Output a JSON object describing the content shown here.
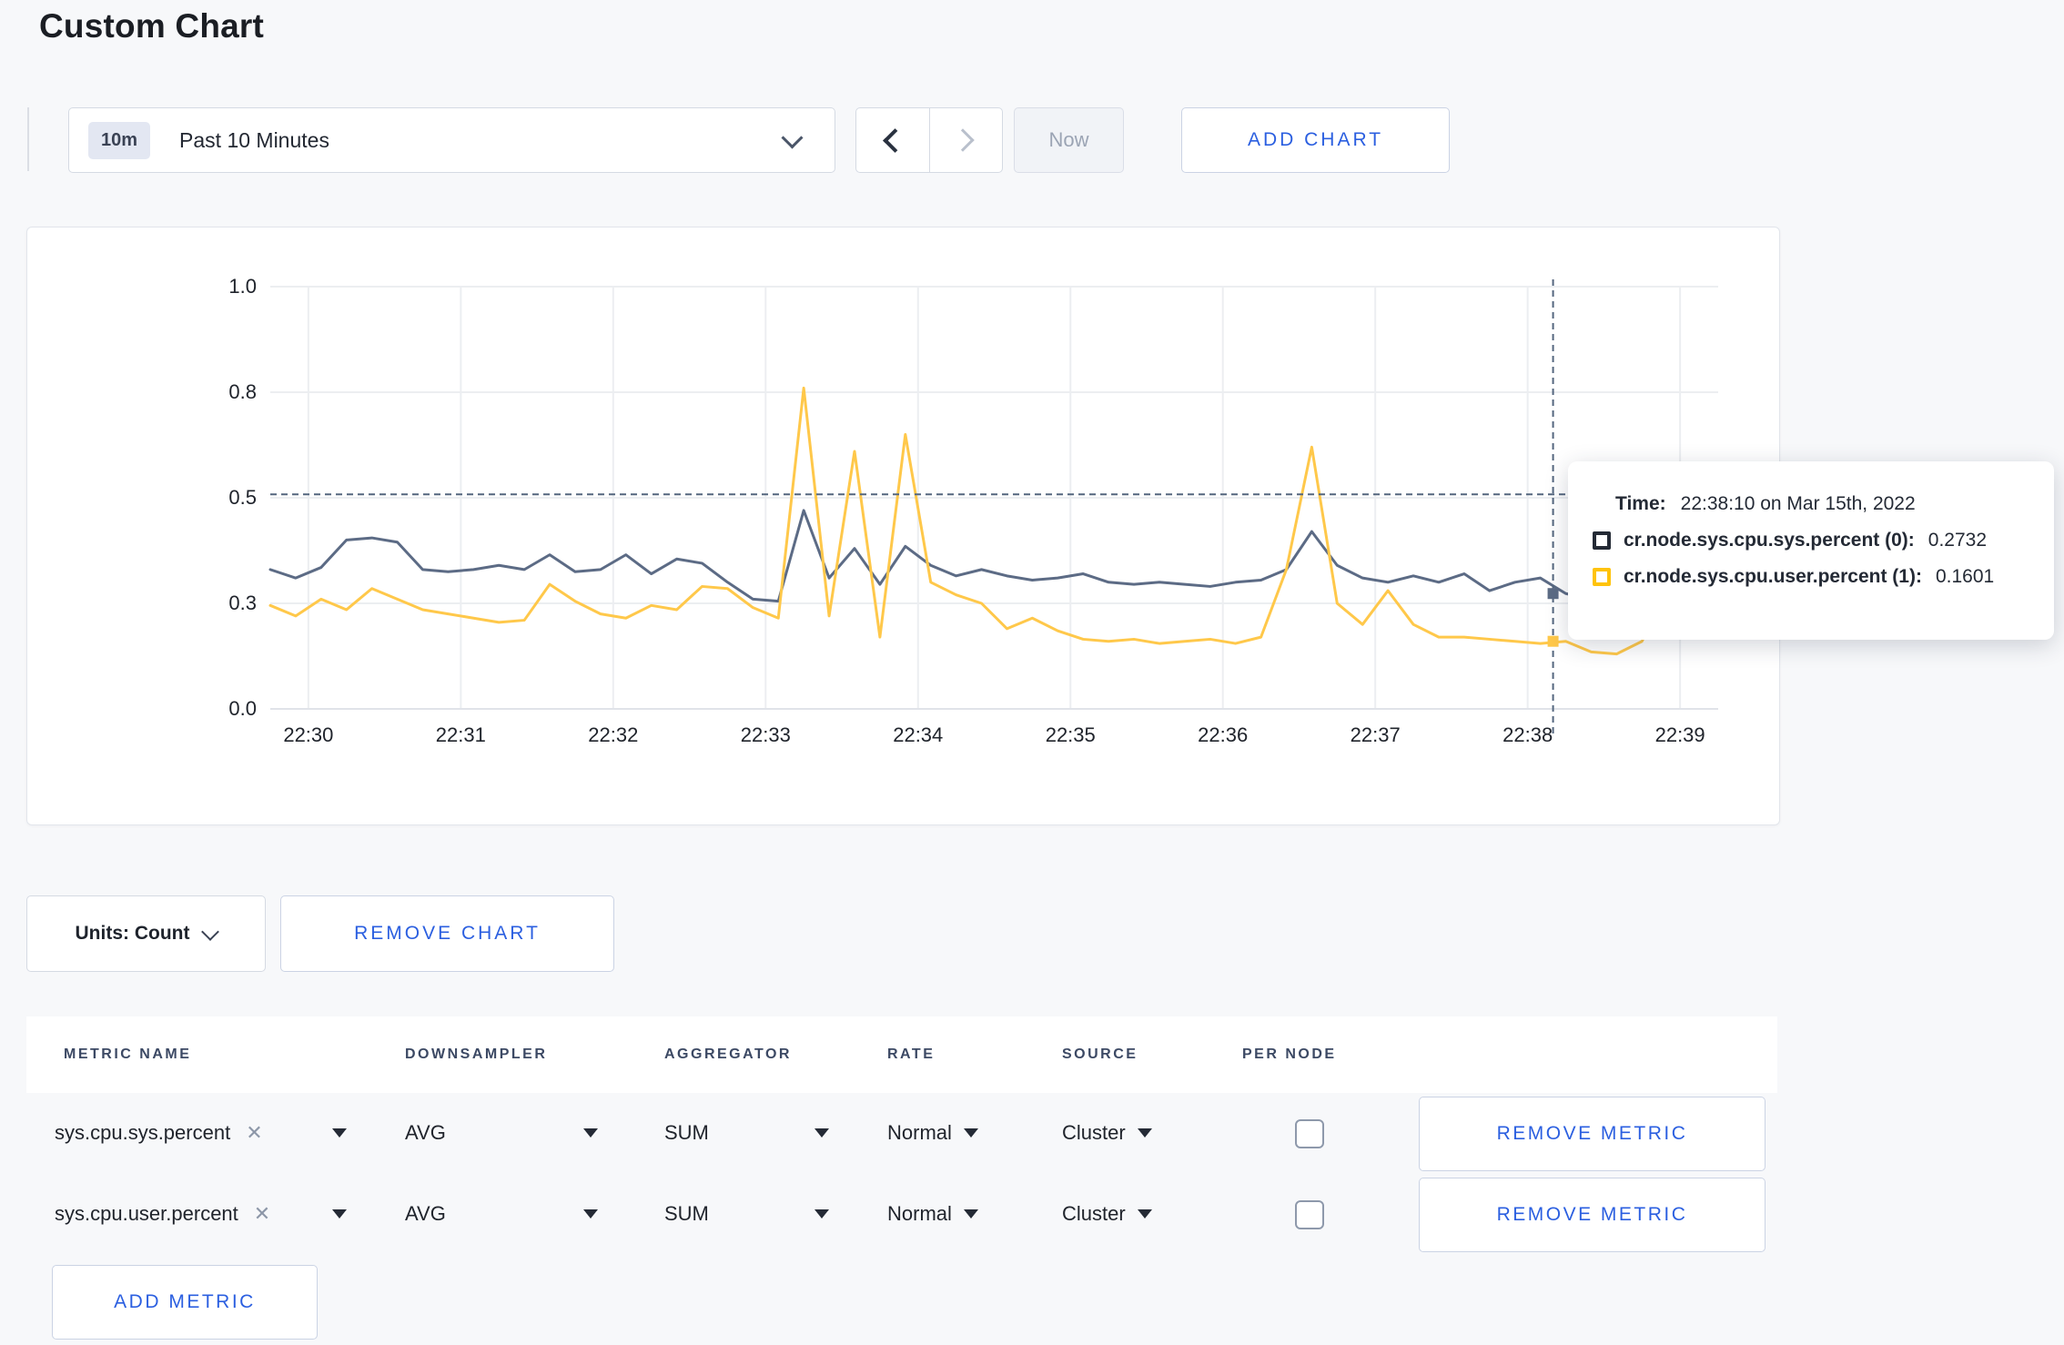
{
  "page": {
    "title": "Custom Chart"
  },
  "colors": {
    "accent_blue": "#2B5FE0",
    "navy_text": "#242A35",
    "series_sys": "#5C6B85",
    "series_user": "#FFC84A",
    "crosshair": "#54667E",
    "gridline": "#ECEEF1",
    "page_background": "#F7F8FA"
  },
  "toolbar": {
    "range_badge": "10m",
    "range_label": "Past 10 Minutes",
    "now_label": "Now",
    "add_chart_label": "ADD CHART"
  },
  "chart_data": {
    "type": "line",
    "title": "",
    "xlabel": "",
    "ylabel": "",
    "x_unit": "seconds after 22:29:45 on Mar 15th, 2022",
    "x_seconds": [
      0,
      10,
      20,
      30,
      40,
      50,
      60,
      70,
      80,
      90,
      100,
      110,
      120,
      130,
      140,
      150,
      160,
      170,
      180,
      190,
      200,
      210,
      220,
      230,
      240,
      250,
      260,
      270,
      280,
      290,
      300,
      310,
      320,
      330,
      340,
      350,
      360,
      370,
      380,
      390,
      400,
      410,
      420,
      430,
      440,
      450,
      460,
      470,
      480,
      490,
      500,
      510,
      520,
      530,
      540,
      550,
      560,
      570
    ],
    "x_tick_seconds": [
      15,
      75,
      135,
      195,
      255,
      315,
      375,
      435,
      495,
      555
    ],
    "x_tick_labels": [
      "22:30",
      "22:31",
      "22:32",
      "22:33",
      "22:34",
      "22:35",
      "22:36",
      "22:37",
      "22:38",
      "22:39"
    ],
    "y_tick_values": [
      0,
      0.25,
      0.5,
      0.75,
      1.0
    ],
    "y_tick_labels": [
      "0.0",
      "0.3",
      "0.5",
      "0.8",
      "1.0"
    ],
    "ylim": [
      0,
      1
    ],
    "grid": true,
    "legend_position": "none",
    "series": [
      {
        "name": "cr.node.sys.cpu.sys.percent",
        "color": "#5C6B85",
        "values": [
          0.33,
          0.31,
          0.335,
          0.4,
          0.405,
          0.395,
          0.33,
          0.325,
          0.33,
          0.34,
          0.33,
          0.365,
          0.325,
          0.33,
          0.365,
          0.32,
          0.355,
          0.345,
          0.3,
          0.26,
          0.255,
          0.47,
          0.31,
          0.38,
          0.295,
          0.385,
          0.34,
          0.315,
          0.33,
          0.315,
          0.305,
          0.31,
          0.32,
          0.3,
          0.295,
          0.3,
          0.295,
          0.29,
          0.3,
          0.305,
          0.33,
          0.42,
          0.34,
          0.31,
          0.3,
          0.315,
          0.3,
          0.32,
          0.28,
          0.3,
          0.31,
          0.2732,
          0.26,
          0.28,
          0.29,
          0.295,
          0.3,
          0.3
        ]
      },
      {
        "name": "cr.node.sys.cpu.user.percent",
        "color": "#FFC84A",
        "values": [
          0.245,
          0.22,
          0.26,
          0.235,
          0.285,
          0.26,
          0.235,
          0.225,
          0.215,
          0.205,
          0.21,
          0.295,
          0.255,
          0.225,
          0.215,
          0.245,
          0.235,
          0.29,
          0.285,
          0.24,
          0.215,
          0.76,
          0.22,
          0.61,
          0.17,
          0.65,
          0.3,
          0.27,
          0.25,
          0.19,
          0.215,
          0.185,
          0.165,
          0.16,
          0.165,
          0.155,
          0.16,
          0.165,
          0.155,
          0.17,
          0.33,
          0.62,
          0.25,
          0.2,
          0.28,
          0.2,
          0.17,
          0.17,
          0.165,
          0.16,
          0.155,
          0.1601,
          0.135,
          0.13,
          0.16,
          0.28,
          0.17,
          0.26
        ]
      }
    ],
    "crosshair": {
      "t_seconds": 505,
      "time_label": "22:38:10",
      "hline_value": 0.508,
      "point_values": [
        0.2732,
        0.1601
      ]
    }
  },
  "tooltip": {
    "time_label": "Time:",
    "time_value": "22:38:10 on Mar 15th, 2022",
    "rows": [
      {
        "name": "cr.node.sys.cpu.sys.percent (0):",
        "value": "0.2732",
        "swatch_color": "#242A35"
      },
      {
        "name": "cr.node.sys.cpu.user.percent (1):",
        "value": "0.1601",
        "swatch_color": "#FFC30B"
      }
    ]
  },
  "chart_footer": {
    "units_label": "Units: Count",
    "remove_chart_label": "REMOVE CHART"
  },
  "metrics_table": {
    "columns": [
      "METRIC NAME",
      "DOWNSAMPLER",
      "AGGREGATOR",
      "RATE",
      "SOURCE",
      "PER NODE"
    ],
    "rows": [
      {
        "name": "sys.cpu.sys.percent",
        "downsampler": "AVG",
        "aggregator": "SUM",
        "rate": "Normal",
        "source": "Cluster",
        "per_node_checked": false
      },
      {
        "name": "sys.cpu.user.percent",
        "downsampler": "AVG",
        "aggregator": "SUM",
        "rate": "Normal",
        "source": "Cluster",
        "per_node_checked": false
      }
    ],
    "remove_metric_label": "REMOVE METRIC",
    "add_metric_label": "ADD METRIC"
  },
  "icons": {
    "close_glyph": "✕"
  }
}
